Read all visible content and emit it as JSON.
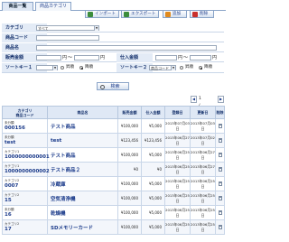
{
  "tabs": {
    "active": "商品一覧",
    "inactive": "商品カテゴリ"
  },
  "toolbar": {
    "import_label": "インポート",
    "export_label": "エクスポート",
    "add_label": "追加",
    "delete_label": "削除"
  },
  "form": {
    "category_label": "カテゴリ",
    "category_value": "すべて",
    "product_code_label": "商品コード",
    "product_name_label": "商品名",
    "sale_price_label": "販売金額",
    "purchase_price_label": "仕入金額",
    "yen_symbol": "円",
    "range_sep": "～",
    "sort1_label": "ソートキー１",
    "sort1_value": "",
    "sort2_label": "ソートキー２",
    "sort2_value": "商品コード",
    "asc_label": "昇順",
    "desc_label": "降順",
    "search_label": "検索"
  },
  "pager": {
    "prev": "◀",
    "next": "▶",
    "page_text": "1 / 3"
  },
  "table": {
    "headers": {
      "code": "カテゴリ\n商品コード",
      "name": "商品名",
      "sale": "販売金額",
      "purchase": "仕入金額",
      "created": "登録日",
      "updated": "更新日",
      "delete": "削除"
    },
    "rows": [
      {
        "category": "未分類",
        "code": "000156",
        "name": "テスト商品",
        "sale": "¥100,000",
        "purchase": "¥5,000",
        "created": "2013年07月03日",
        "updated": "2013年07月03日"
      },
      {
        "category": "未分類",
        "code": "test",
        "name": "test",
        "sale": "¥123,456",
        "purchase": "¥123,456",
        "created": "2013年06月27日",
        "updated": "2013年07月02日"
      },
      {
        "category": "カテゴリ1",
        "code": "1000000000001",
        "name": "テスト商品",
        "sale": "¥100,000",
        "purchase": "¥5,000",
        "created": "2013年06月25日",
        "updated": "2013年06月27日"
      },
      {
        "category": "カテゴリ1",
        "code": "1000000000002",
        "name": "テスト商品２",
        "sale": "¥0",
        "purchase": "¥0",
        "created": "2013年06月25日",
        "updated": "2013年06月27日"
      },
      {
        "category": "カテゴリ2",
        "code": "0007",
        "name": "冷蔵庫",
        "sale": "¥100,000",
        "purchase": "¥5,000",
        "created": "2013年06月25日",
        "updated": "2013年06月25日"
      },
      {
        "category": "カテゴリ2",
        "code": "15",
        "name": "空気清浄機",
        "sale": "¥100,000",
        "purchase": "¥5,000",
        "created": "2013年06月25日",
        "updated": "2013年06月25日"
      },
      {
        "category": "未分類",
        "code": "16",
        "name": "乾燥機",
        "sale": "¥100,000",
        "purchase": "¥5,000",
        "created": "2013年06月25日",
        "updated": "2013年06月25日"
      },
      {
        "category": "カテゴリ2",
        "code": "17",
        "name": "SDメモリーカード",
        "sale": "¥100,000",
        "purchase": "¥5,000",
        "created": "2013年06月25日",
        "updated": "2013年06月25日"
      }
    ]
  }
}
